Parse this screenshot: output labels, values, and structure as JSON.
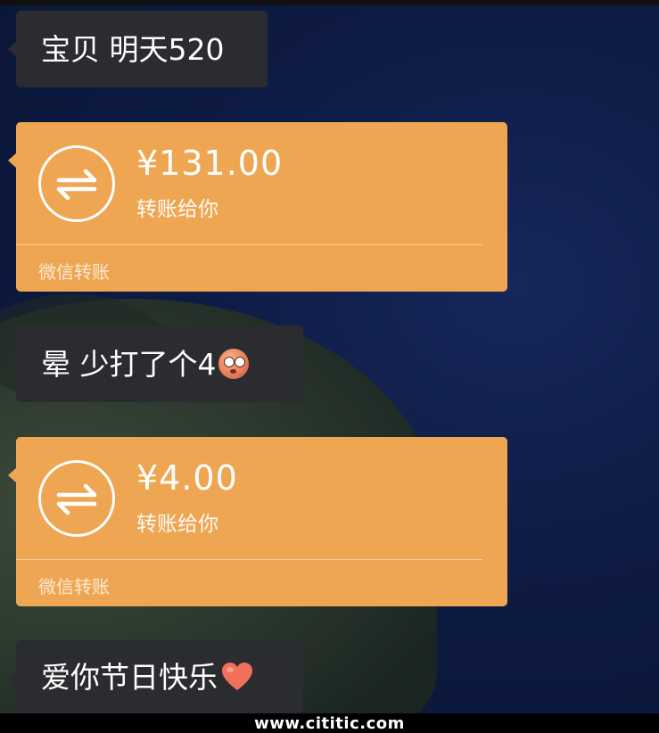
{
  "messages": [
    {
      "text": "宝贝 明天520"
    },
    {
      "text": "晕 少打了个4",
      "emoji": "embarrassed-face-emoji"
    },
    {
      "text": "爱你节日快乐",
      "emoji": "heart-emoji"
    }
  ],
  "transfers": [
    {
      "amount": "¥131.00",
      "subtitle": "转账给你",
      "footer": "微信转账",
      "icon": "transfer-arrows-icon"
    },
    {
      "amount": "¥4.00",
      "subtitle": "转账给你",
      "footer": "微信转账",
      "icon": "transfer-arrows-icon"
    }
  ],
  "watermark": "www.cititic.com",
  "colors": {
    "chat_bubble": "#2b2c30",
    "transfer_card": "#efa653",
    "background": "#0e1b44"
  }
}
